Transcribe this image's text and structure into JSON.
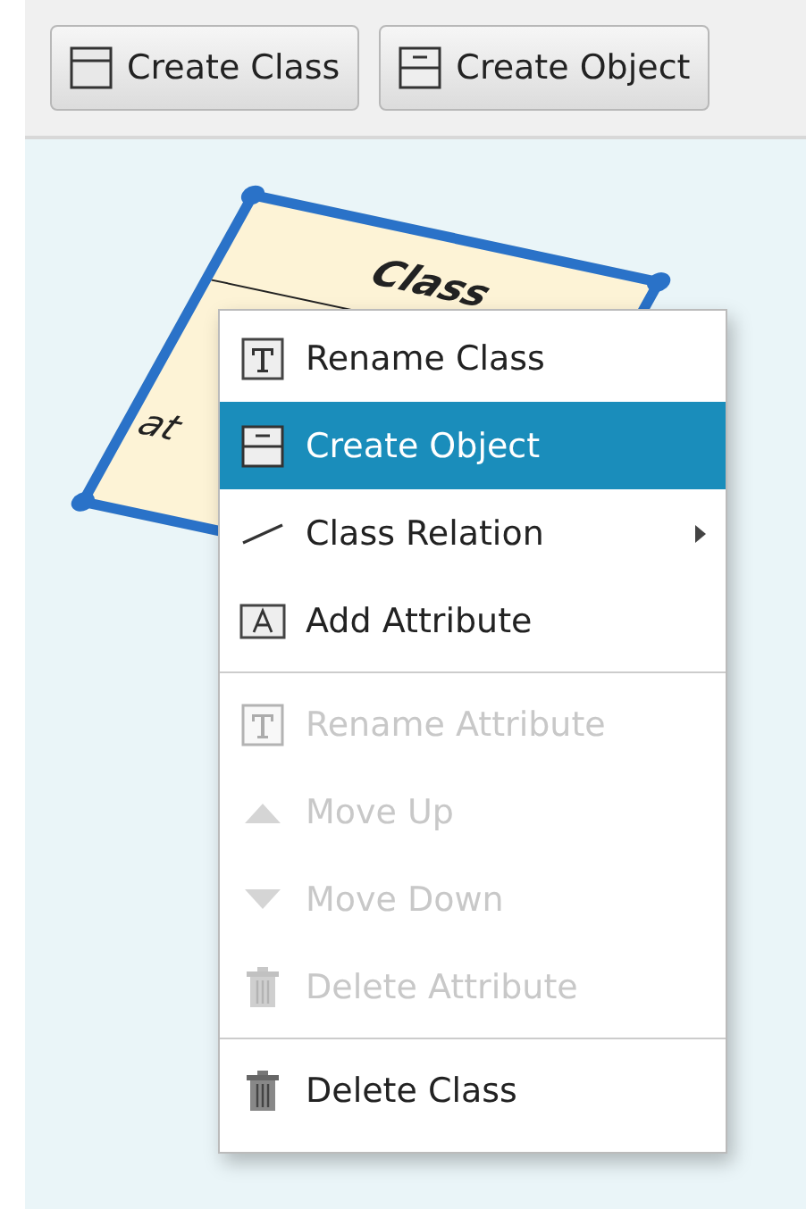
{
  "toolbar": {
    "buttons": [
      {
        "label": "Create Class"
      },
      {
        "label": "Create Object"
      }
    ]
  },
  "class_box": {
    "title": "Class",
    "attributes": [
      "at"
    ],
    "selected": true
  },
  "context_menu": {
    "items": [
      {
        "kind": "item",
        "label": "Rename Class",
        "selected": false,
        "disabled": false,
        "submenu": false
      },
      {
        "kind": "item",
        "label": "Create Object",
        "selected": true,
        "disabled": false,
        "submenu": false
      },
      {
        "kind": "item",
        "label": "Class Relation",
        "selected": false,
        "disabled": false,
        "submenu": true
      },
      {
        "kind": "item",
        "label": "Add Attribute",
        "selected": false,
        "disabled": false,
        "submenu": false
      },
      {
        "kind": "separator"
      },
      {
        "kind": "item",
        "label": "Rename Attribute",
        "selected": false,
        "disabled": true,
        "submenu": false
      },
      {
        "kind": "item",
        "label": "Move Up",
        "selected": false,
        "disabled": true,
        "submenu": false
      },
      {
        "kind": "item",
        "label": "Move Down",
        "selected": false,
        "disabled": true,
        "submenu": false
      },
      {
        "kind": "item",
        "label": "Delete Attribute",
        "selected": false,
        "disabled": true,
        "submenu": false
      },
      {
        "kind": "separator"
      },
      {
        "kind": "item",
        "label": "Delete Class",
        "selected": false,
        "disabled": false,
        "submenu": false
      }
    ]
  }
}
